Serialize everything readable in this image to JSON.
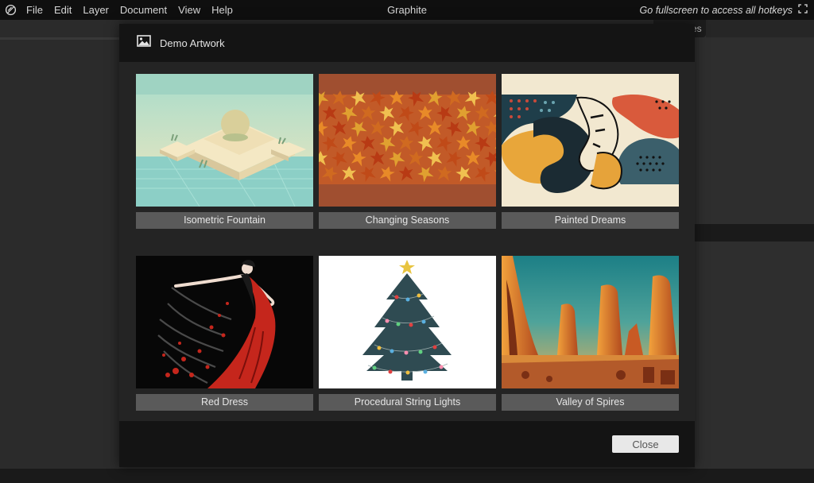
{
  "app": {
    "title": "Graphite",
    "fullscreen_hint": "Go fullscreen to access all hotkeys",
    "logo_icon": "graphite-logo-icon",
    "fullscreen_icon": "fullscreen-icon"
  },
  "menu": [
    {
      "label": "File"
    },
    {
      "label": "Edit"
    },
    {
      "label": "Layer"
    },
    {
      "label": "Document"
    },
    {
      "label": "View"
    },
    {
      "label": "Help"
    }
  ],
  "background": {
    "partial_tab_label": "es"
  },
  "dialog": {
    "title": "Demo Artwork",
    "icon": "image-icon",
    "close_label": "Close",
    "artworks": [
      {
        "label": "Isometric Fountain"
      },
      {
        "label": "Changing Seasons"
      },
      {
        "label": "Painted Dreams"
      },
      {
        "label": "Red Dress"
      },
      {
        "label": "Procedural String Lights"
      },
      {
        "label": "Valley of Spires"
      }
    ]
  },
  "colors": {
    "titlebar": "#0f0f0f",
    "dialog_bg": "#242424",
    "dialog_header": "#141414",
    "tile_label_bg": "#5a5a5a",
    "close_button_bg": "#e8e8e8"
  }
}
